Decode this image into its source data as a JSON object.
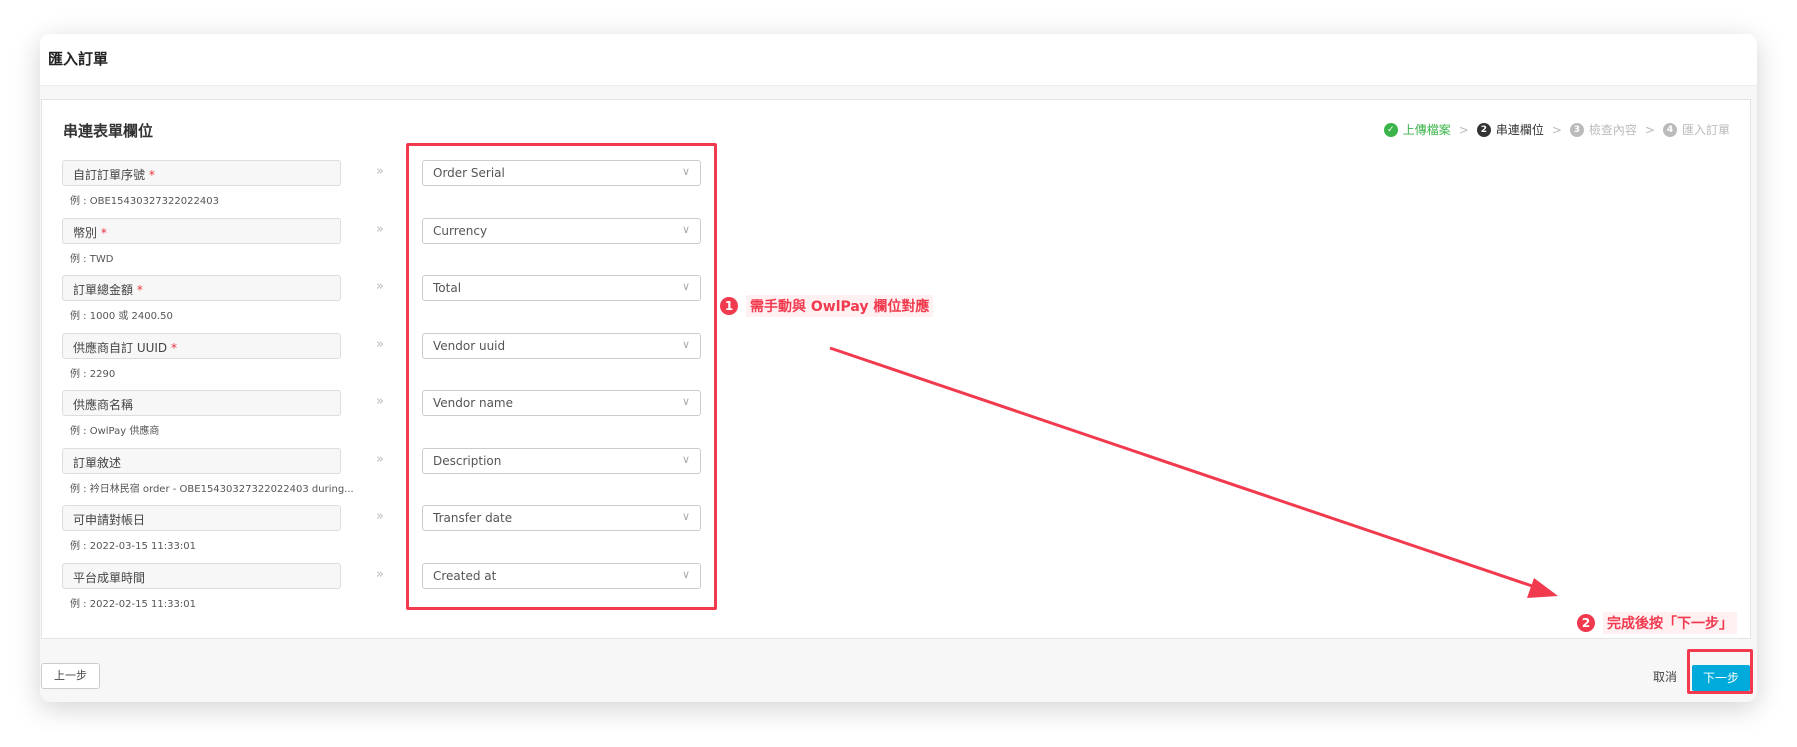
{
  "header": {
    "title": "匯入訂單"
  },
  "section_title": "串連表單欄位",
  "steps": [
    {
      "label": "上傳檔案",
      "state": "done",
      "icon": "check-icon"
    },
    {
      "num": "2",
      "label": "串連欄位",
      "state": "current"
    },
    {
      "num": "3",
      "label": "檢查內容",
      "state": "pending"
    },
    {
      "num": "4",
      "label": "匯入訂單",
      "state": "pending"
    }
  ],
  "step_separator": ">",
  "fields": [
    {
      "label": "自訂訂單序號",
      "required": "*",
      "example": "例 : OBE15430327322022403",
      "mapped": "Order Serial"
    },
    {
      "label": "幣別",
      "required": "*",
      "example": "例 : TWD",
      "mapped": "Currency"
    },
    {
      "label": "訂單總金額",
      "required": "*",
      "example": "例 : 1000 或 2400.50",
      "mapped": "Total"
    },
    {
      "label": "供應商自訂 UUID",
      "required": "*",
      "example": "例 : 2290",
      "mapped": "Vendor uuid"
    },
    {
      "label": "供應商名稱",
      "required": "",
      "example": "例 : OwlPay 供應商",
      "mapped": "Vendor name"
    },
    {
      "label": "訂單敘述",
      "required": "",
      "example": "例 : 衿日林民宿 order - OBE15430327322022403 during...",
      "mapped": "Description"
    },
    {
      "label": "可申請對帳日",
      "required": "",
      "example": "例 : 2022-03-15 11:33:01",
      "mapped": "Transfer date"
    },
    {
      "label": "平台成單時間",
      "required": "",
      "example": "例 : 2022-02-15 11:33:01",
      "mapped": "Created at"
    }
  ],
  "footer": {
    "prev": "上一步",
    "cancel": "取消",
    "next": "下一步"
  },
  "annotations": [
    {
      "num": "1",
      "text": "需手動與 OwlPay 欄位對應"
    },
    {
      "num": "2",
      "text": "完成後按「下一步」"
    }
  ],
  "colors": {
    "accent": "#00abdc",
    "annotation": "#f23a4f",
    "done": "#3bb54a"
  }
}
